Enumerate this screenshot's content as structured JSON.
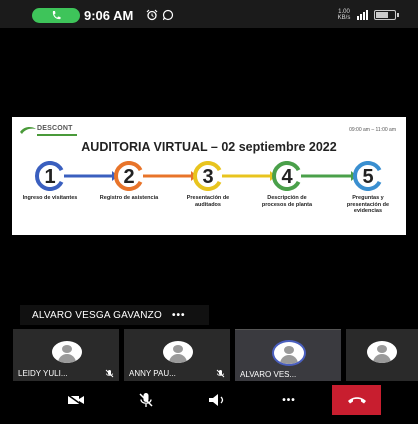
{
  "status_bar": {
    "time": "9:06 AM",
    "net_speed": "1.00\nKB/s",
    "icons": [
      "phone-icon",
      "alarm-icon",
      "whatsapp-icon",
      "signal-icon",
      "battery-icon"
    ],
    "battery_level": 0.7
  },
  "slide": {
    "logo_name": "DESCONT",
    "time_range": "09:00 am – 11:00 am",
    "title": "AUDITORIA VIRTUAL – 02 septiembre 2022",
    "steps": [
      {
        "number": "1",
        "label": "Ingreso de visitantes",
        "color": "#3a5fbf"
      },
      {
        "number": "2",
        "label": "Registro de asistencia",
        "color": "#e8742a"
      },
      {
        "number": "3",
        "label": "Presentación de auditados",
        "color": "#e8c41e"
      },
      {
        "number": "4",
        "label": "Descripción de procesos de planta",
        "color": "#4aa04a"
      },
      {
        "number": "5",
        "label": "Preguntas y presentación de evidencias",
        "color": "#3a8fd0"
      }
    ]
  },
  "speaker": {
    "name": "ALVARO VESGA GAVANZO",
    "more": "•••"
  },
  "participants": [
    {
      "name": "LEIDY YULI...",
      "muted": true,
      "active": false
    },
    {
      "name": "ANNY PAU...",
      "muted": true,
      "active": false
    },
    {
      "name": "ALVARO VES...",
      "muted": false,
      "active": true
    },
    {
      "name": "",
      "muted": false,
      "active": false
    }
  ],
  "controls": {
    "camera": "camera-off-icon",
    "mic": "mic-off-icon",
    "speaker": "speaker-icon",
    "more": "•••",
    "end": "end-call-icon",
    "end_color": "#c81e2f"
  }
}
